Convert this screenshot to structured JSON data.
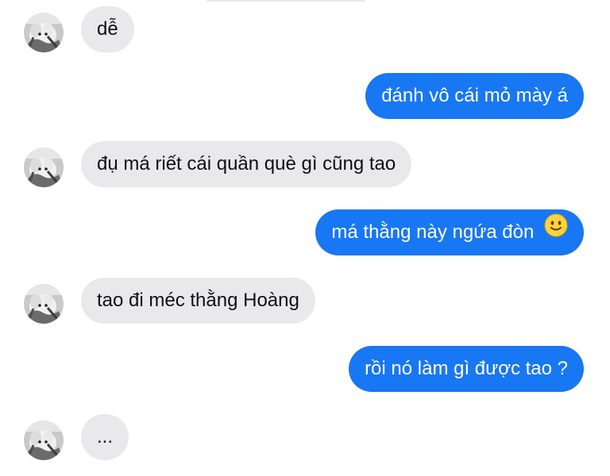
{
  "conversation": {
    "messages": [
      {
        "side": "in",
        "text": "dễ"
      },
      {
        "side": "out",
        "text": "đánh vô cái mỏ mày á"
      },
      {
        "side": "in",
        "text": "đụ má riết cái quần què gì cũng tao"
      },
      {
        "side": "out",
        "text": "má thằng này ngứa đòn",
        "emoji": "slightly-smiling-face"
      },
      {
        "side": "in",
        "text": "tao đi méc thằng Hoàng"
      },
      {
        "side": "out",
        "text": "rồi nó làm gì được tao ?"
      },
      {
        "side": "in",
        "text": "..."
      }
    ]
  },
  "colors": {
    "incoming_bubble": "#e9e9eb",
    "outgoing_bubble": "#1877f2",
    "incoming_text": "#101010",
    "outgoing_text": "#ffffff"
  }
}
